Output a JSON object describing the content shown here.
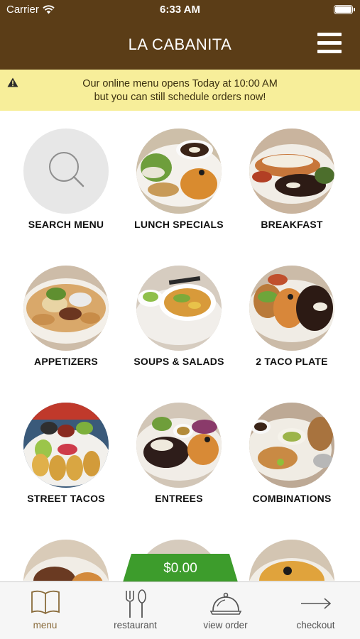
{
  "status_bar": {
    "carrier": "Carrier",
    "time": "6:33 AM"
  },
  "header": {
    "title": "LA CABANITA",
    "menu_icon": "hamburger-menu-icon"
  },
  "notice": {
    "icon": "warning-icon",
    "line1": "Our online menu opens Today at 10:00 AM",
    "line2": "but you can still schedule orders now!"
  },
  "categories": [
    {
      "label": "SEARCH MENU"
    },
    {
      "label": "LUNCH SPECIALS"
    },
    {
      "label": "BREAKFAST"
    },
    {
      "label": "APPETIZERS"
    },
    {
      "label": "SOUPS & SALADS"
    },
    {
      "label": "2 TACO PLATE"
    },
    {
      "label": "STREET TACOS"
    },
    {
      "label": "ENTREES"
    },
    {
      "label": "COMBINATIONS"
    }
  ],
  "cart": {
    "total": "$0.00"
  },
  "tabs": [
    {
      "label": "menu",
      "icon": "book-icon",
      "active": true
    },
    {
      "label": "restaurant",
      "icon": "fork-knife-icon",
      "active": false
    },
    {
      "label": "view order",
      "icon": "cloche-icon",
      "active": false
    },
    {
      "label": "checkout",
      "icon": "arrow-right-icon",
      "active": false
    }
  ],
  "colors": {
    "header_bg": "#5b3d17",
    "notice_bg": "#f7ee9a",
    "cart_green": "#3d9c2c",
    "active_tab": "#8a6c3c"
  }
}
